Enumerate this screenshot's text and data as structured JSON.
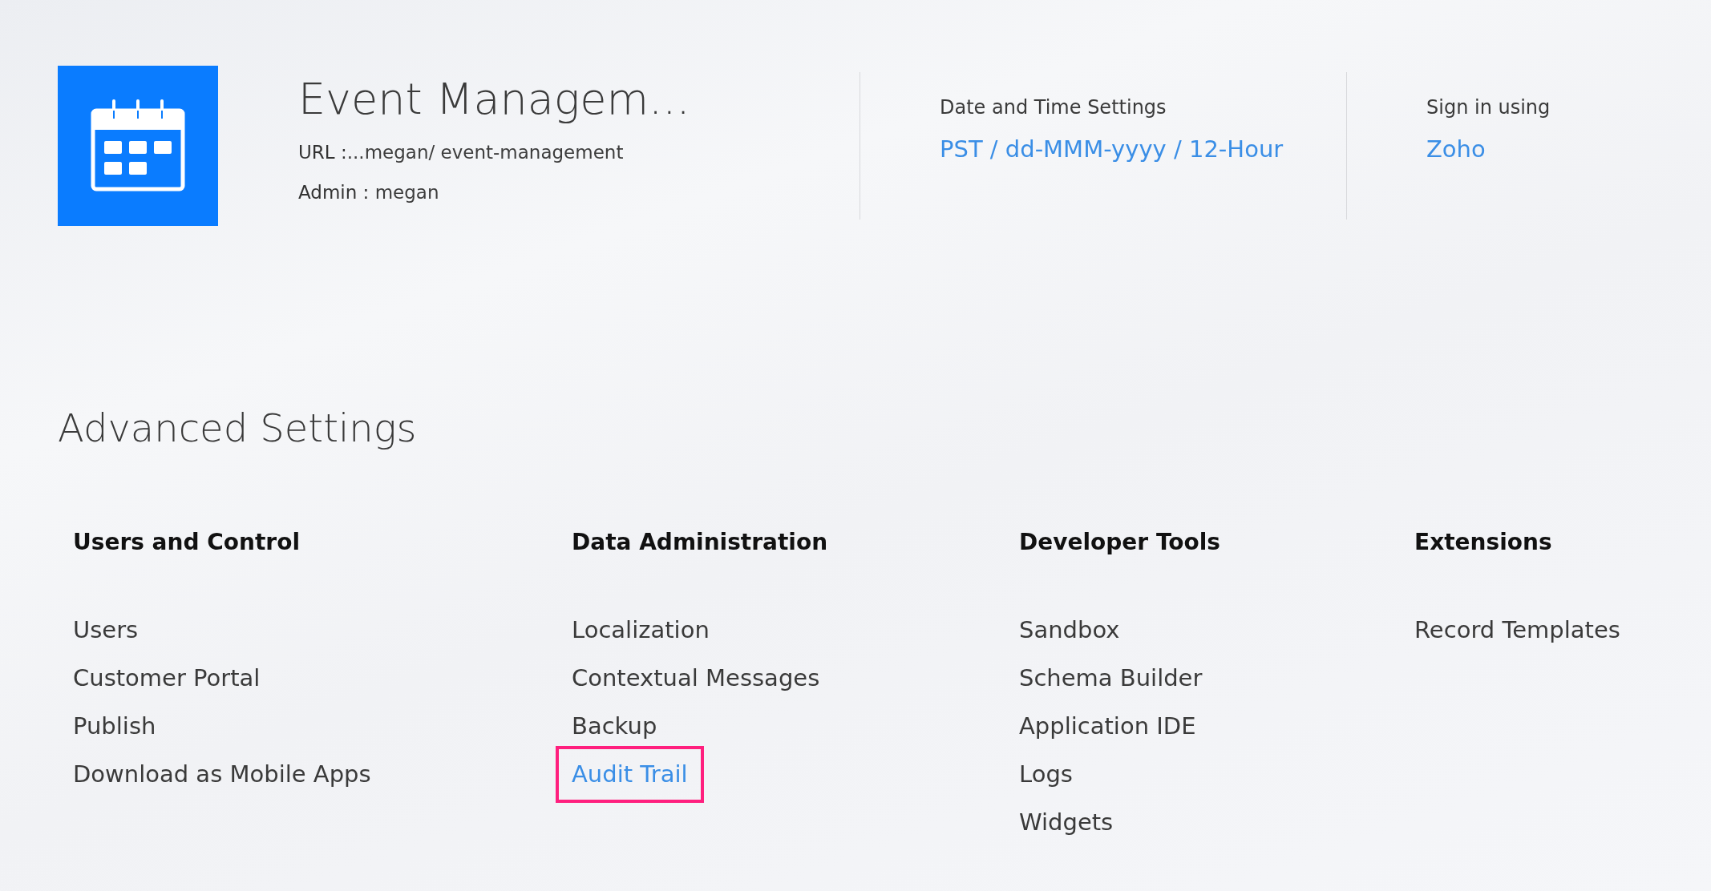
{
  "app": {
    "name": "Event Managem...",
    "url_label": "URL :",
    "url": "...megan/ event-management",
    "admin_label": "Admin :",
    "admin": "megan"
  },
  "header_settings": [
    {
      "label": "Date and Time Settings",
      "value": "PST / dd-MMM-yyyy / 12-Hour"
    },
    {
      "label": "Sign in using",
      "value": "Zoho"
    }
  ],
  "advanced_settings": {
    "title": "Advanced Settings",
    "groups": [
      {
        "title": "Users and Control",
        "items": [
          {
            "label": "Users",
            "highlighted": false
          },
          {
            "label": "Customer Portal",
            "highlighted": false
          },
          {
            "label": "Publish",
            "highlighted": false
          },
          {
            "label": "Download as Mobile Apps",
            "highlighted": false
          }
        ]
      },
      {
        "title": "Data Administration",
        "items": [
          {
            "label": "Localization",
            "highlighted": false
          },
          {
            "label": "Contextual Messages",
            "highlighted": false
          },
          {
            "label": "Backup",
            "highlighted": false
          },
          {
            "label": "Audit Trail",
            "highlighted": true
          }
        ]
      },
      {
        "title": "Developer Tools",
        "items": [
          {
            "label": "Sandbox",
            "highlighted": false
          },
          {
            "label": "Schema Builder",
            "highlighted": false
          },
          {
            "label": "Application IDE",
            "highlighted": false
          },
          {
            "label": "Logs",
            "highlighted": false
          },
          {
            "label": "Widgets",
            "highlighted": false
          }
        ]
      },
      {
        "title": "Extensions",
        "items": [
          {
            "label": "Record Templates",
            "highlighted": false
          }
        ]
      }
    ]
  }
}
